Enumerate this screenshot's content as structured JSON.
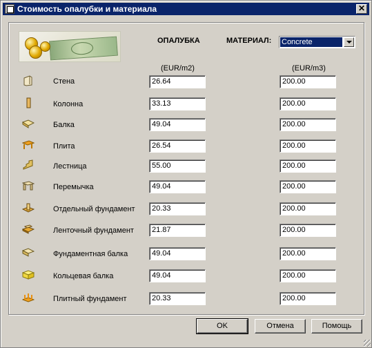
{
  "window": {
    "title": "Стоимость опалубки и материала",
    "close_glyph": "✕"
  },
  "header": {
    "formwork_label": "ОПАЛУБКА",
    "material_label": "МАТЕРИАЛ:",
    "material_value": "Concrete",
    "unit_formwork": "(EUR/m2)",
    "unit_material": "(EUR/m3)"
  },
  "rows": [
    {
      "label": "Стена",
      "icon": "wall-icon",
      "formwork": "26.64",
      "material": "200.00"
    },
    {
      "label": "Колонна",
      "icon": "column-icon",
      "formwork": "33.13",
      "material": "200.00"
    },
    {
      "label": "Балка",
      "icon": "beam-icon",
      "formwork": "49.04",
      "material": "200.00"
    },
    {
      "label": "Плита",
      "icon": "slab-icon",
      "formwork": "26.54",
      "material": "200.00"
    },
    {
      "label": "Лестница",
      "icon": "stairs-icon",
      "formwork": "55.00",
      "material": "200.00"
    },
    {
      "label": "Перемычка",
      "icon": "lintel-icon",
      "formwork": "49.04",
      "material": "200.00"
    },
    {
      "label": "Отдельный фундамент",
      "icon": "isolated-footing-icon",
      "formwork": "20.33",
      "material": "200.00"
    },
    {
      "label": "Ленточный фундамент",
      "icon": "strip-footing-icon",
      "formwork": "21.87",
      "material": "200.00"
    },
    {
      "label": "Фундаментная балка",
      "icon": "foundation-beam-icon",
      "formwork": "49.04",
      "material": "200.00"
    },
    {
      "label": "Кольцевая балка",
      "icon": "ring-beam-icon",
      "formwork": "49.04",
      "material": "200.00"
    },
    {
      "label": "Плитный фундамент",
      "icon": "raft-foundation-icon",
      "formwork": "20.33",
      "material": "200.00"
    }
  ],
  "buttons": {
    "ok": "OK",
    "cancel": "Отмена",
    "help": "Помощь"
  }
}
